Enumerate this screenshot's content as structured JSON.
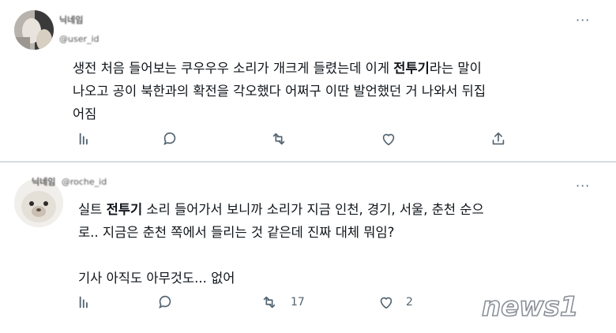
{
  "tweets": [
    {
      "user": {
        "name": "닉네임",
        "handle": "@user_id"
      },
      "more_label": "···",
      "lines": [
        [
          {
            "t": "생전 처음 들어보는 쿠우우우 소리가 개크게 들렸는데 이게 "
          },
          {
            "t": "전투기",
            "b": true
          },
          {
            "t": "라는 말이"
          }
        ],
        [
          {
            "t": "나오고 공이 북한과의 확전을 각오했다 어쩌구 이딴 발언했던 거 나와서 뒤집"
          }
        ],
        [
          {
            "t": "어짐"
          }
        ]
      ],
      "stats": {
        "replies": "",
        "retweets": "",
        "likes": ""
      }
    },
    {
      "user": {
        "name": "닉네임",
        "handle": "@roche_id"
      },
      "more_label": "···",
      "lines": [
        [
          {
            "t": "실트 "
          },
          {
            "t": "전투기",
            "b": true
          },
          {
            "t": " 소리 들어가서 보니까 소리가 지금 인천, 경기, 서울, 춘천 순으"
          }
        ],
        [
          {
            "t": "로.. 지금은 춘천 쪽에서 들리는 것 같은데 진짜 대체 뭐임?"
          }
        ],
        [
          {
            "t": ""
          }
        ],
        [
          {
            "t": "기사 아직도 아무것도... 없어"
          }
        ]
      ],
      "stats": {
        "replies": "",
        "retweets": "17",
        "likes": "2"
      }
    }
  ],
  "watermark": "news1",
  "colors": {
    "icon": "#536471",
    "text": "#0f1419",
    "divider": "#d7dbdf",
    "watermark": "#9aa0a6"
  },
  "icons": [
    "reply-icon",
    "retweet-icon",
    "like-icon",
    "share-icon",
    "more-icon"
  ]
}
